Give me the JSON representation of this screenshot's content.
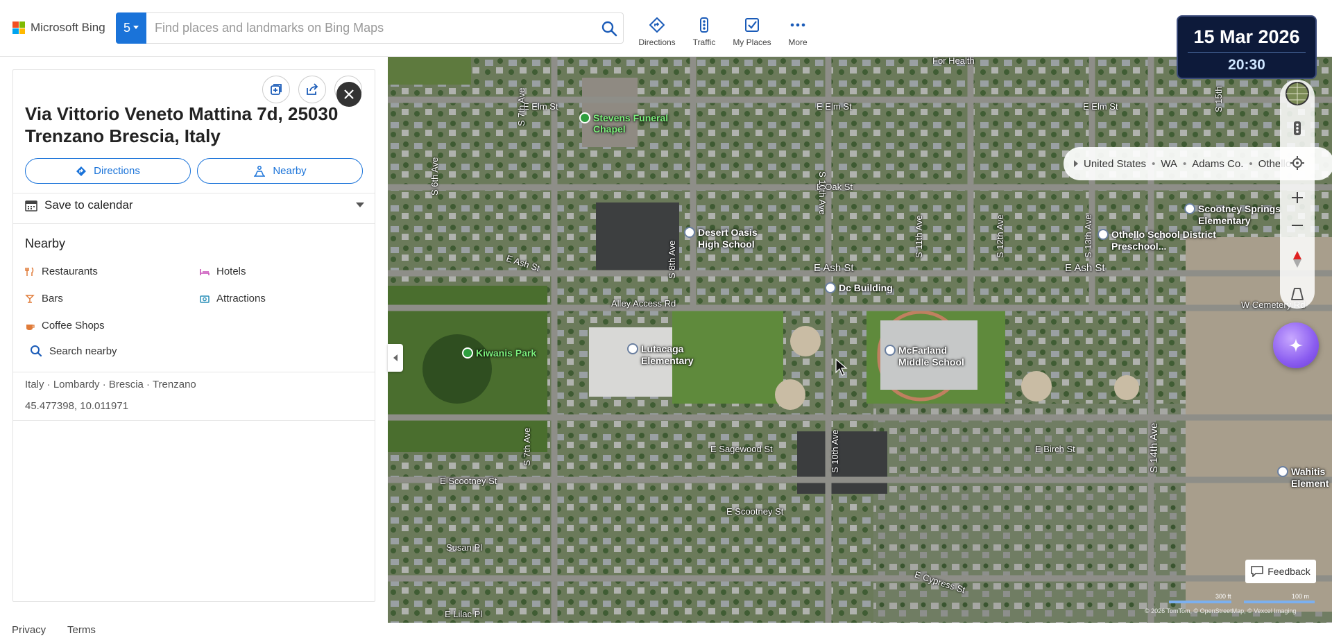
{
  "brand": {
    "name": "Microsoft Bing",
    "logo_colors": [
      "#f25022",
      "#7fba00",
      "#00a4ef",
      "#ffb900"
    ]
  },
  "search": {
    "count": "5",
    "placeholder": "Find places and landmarks on Bing Maps",
    "value": ""
  },
  "toolbar": {
    "items": [
      {
        "label": "Directions",
        "icon": "directions-icon"
      },
      {
        "label": "Traffic",
        "icon": "traffic-icon"
      },
      {
        "label": "My Places",
        "icon": "my-places-icon"
      },
      {
        "label": "More",
        "icon": "more-icon"
      }
    ]
  },
  "datetime": {
    "date": "15 Mar 2026",
    "time": "20:30"
  },
  "panel": {
    "title": "Via Vittorio Veneto Mattina 7d, 25030 Trenzano Brescia, Italy",
    "directions_label": "Directions",
    "nearby_label": "Nearby",
    "calendar_label": "Save to calendar",
    "nearby_heading": "Nearby",
    "nearby_items": [
      {
        "label": "Restaurants",
        "icon": "restaurant-icon",
        "color": "#e07b39"
      },
      {
        "label": "Hotels",
        "icon": "hotel-icon",
        "color": "#c84fb8"
      },
      {
        "label": "Bars",
        "icon": "bar-icon",
        "color": "#e07b39"
      },
      {
        "label": "Attractions",
        "icon": "attraction-icon",
        "color": "#2a8fb8"
      },
      {
        "label": "Coffee Shops",
        "icon": "coffee-icon",
        "color": "#e07b39"
      }
    ],
    "search_nearby_label": "Search nearby",
    "location_path": "Italy · Lombardy · Brescia · Trenzano",
    "coordinates": "45.477398, 10.011971"
  },
  "footer": {
    "privacy": "Privacy",
    "terms": "Terms"
  },
  "map": {
    "breadcrumb": [
      "United States",
      "WA",
      "Adams Co.",
      "Othello"
    ],
    "streets": [
      "E Elm St",
      "E Elm St",
      "E Elm St",
      "E Oak St",
      "E Ash St",
      "E Ash St",
      "E Ash St",
      "Alley Access Rd",
      "W Cemetery Rd",
      "E Sagewood St",
      "E Scootney St",
      "E Scootney St",
      "E Birch St",
      "E Cypress St",
      "Susan Pl",
      "E Lilac Pl",
      "S 7th Ave",
      "S 7th Ave",
      "S 8th Ave",
      "S 10th Ave",
      "S 10th Ave",
      "S 11th Ave",
      "S 12th Ave",
      "S 13th Ave",
      "S 14th Ave",
      "S 15th",
      "S 6th Ave",
      "For Health"
    ],
    "pois": [
      "Stevens Funeral Chapel",
      "Desert Oasis High School",
      "Dc Building",
      "Lutacaga Elementary",
      "McFarland Middle School",
      "Kiwanis Park",
      "Scootney Springs Elementary",
      "Othello School District Preschool...",
      "Wahitis Element"
    ],
    "feedback_label": "Feedback",
    "scale_ft": "300 ft",
    "scale_m": "100 m",
    "copyright": "© 2026 TomTom, © OpenStreetMap, © Vexcel Imaging"
  }
}
